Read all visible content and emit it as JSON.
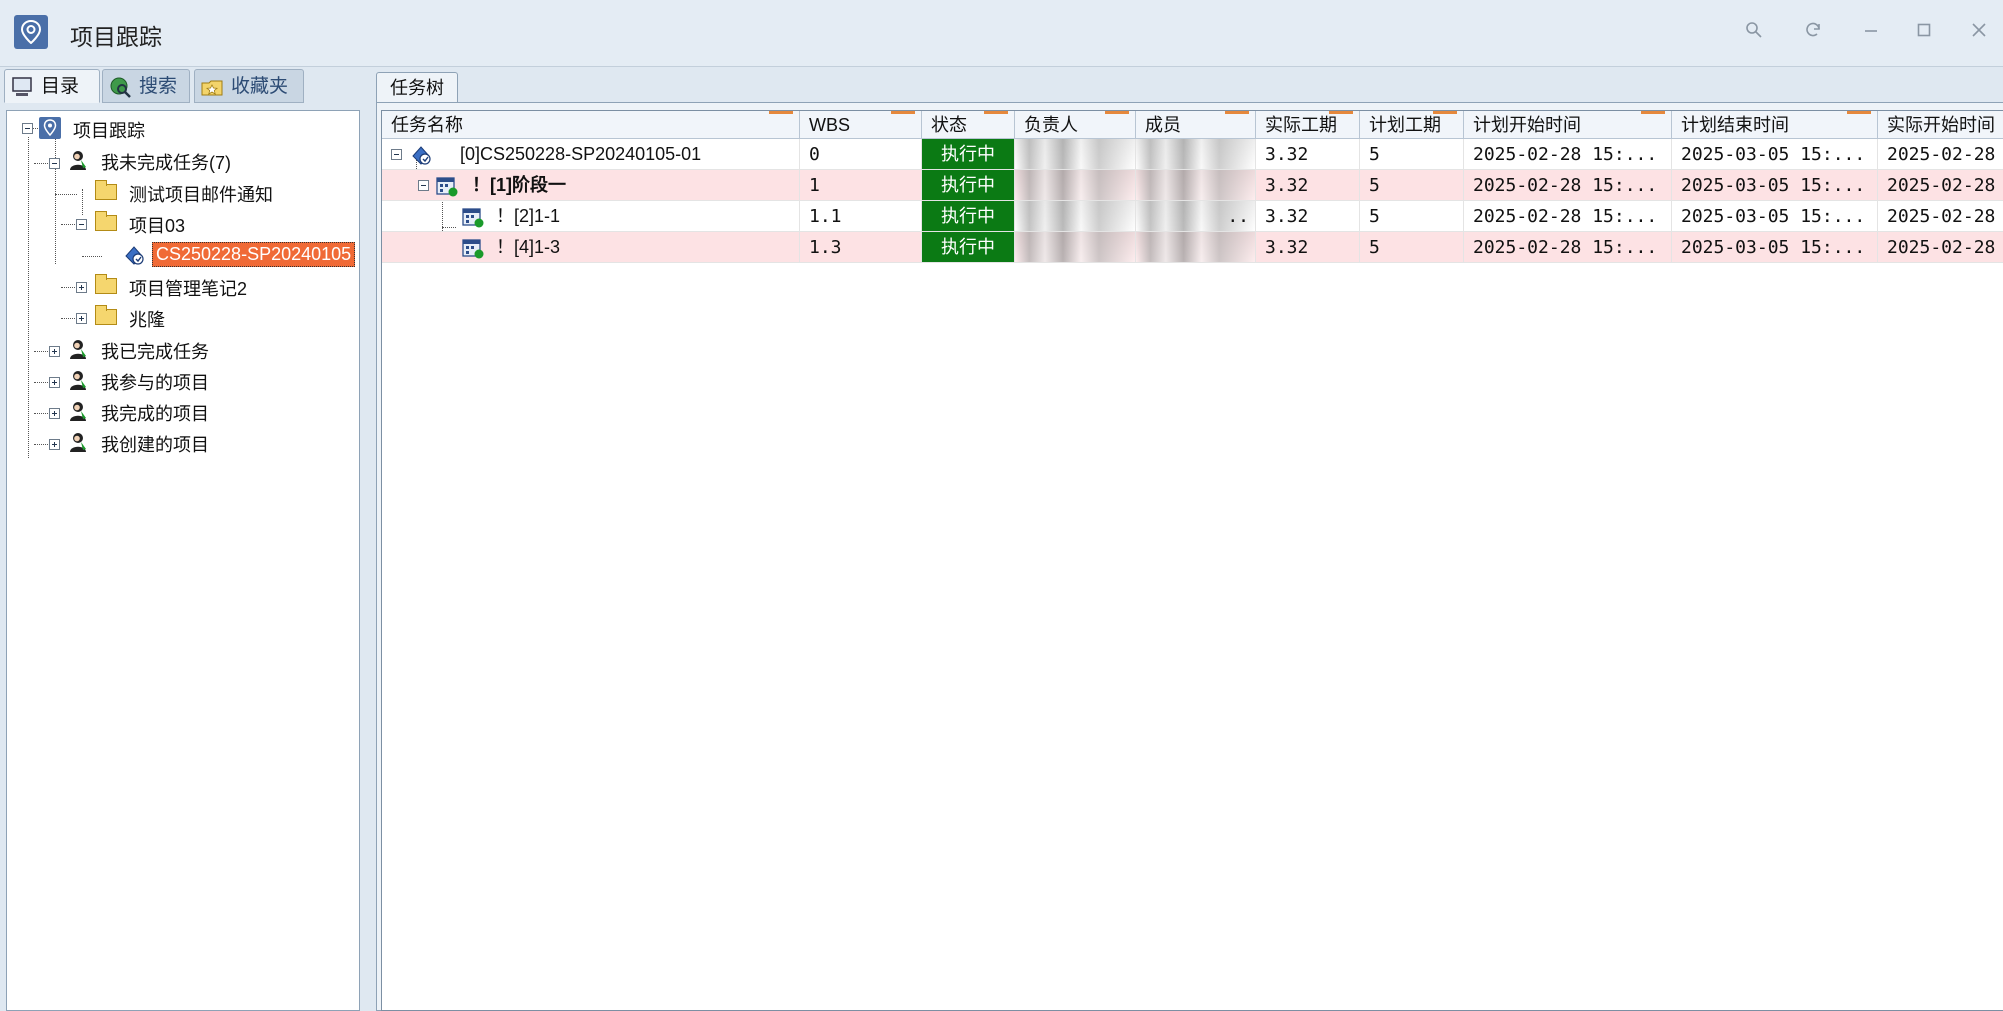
{
  "window": {
    "title": "项目跟踪",
    "controls": [
      "search-icon",
      "refresh-icon",
      "minimize-icon",
      "maximize-icon",
      "close-icon"
    ]
  },
  "left_tabs": [
    {
      "label": "目录",
      "icon": "computer-icon",
      "active": true
    },
    {
      "label": "搜索",
      "icon": "globe-search-icon",
      "active": false
    },
    {
      "label": "收藏夹",
      "icon": "favorites-folder-icon",
      "active": false
    }
  ],
  "tree": {
    "root": "项目跟踪",
    "nodes": [
      {
        "label": "我未完成任务(7)",
        "icon": "person-icon",
        "expanded": true
      },
      {
        "label": "测试项目邮件通知",
        "icon": "folder-icon"
      },
      {
        "label": "项目03",
        "icon": "folder-icon",
        "expanded": true
      },
      {
        "label": "CS250228-SP20240105",
        "icon": "project-icon",
        "selected": true
      },
      {
        "label": "项目管理笔记2",
        "icon": "folder-icon",
        "expanded": false
      },
      {
        "label": "兆隆",
        "icon": "folder-icon",
        "expanded": false
      },
      {
        "label": "我已完成任务",
        "icon": "person-icon",
        "expanded": false
      },
      {
        "label": "我参与的项目",
        "icon": "person-icon",
        "expanded": false
      },
      {
        "label": "我完成的项目",
        "icon": "person-icon",
        "expanded": false
      },
      {
        "label": "我创建的项目",
        "icon": "person-icon",
        "expanded": false
      }
    ]
  },
  "right_tabs": [
    {
      "label": "任务树",
      "active": true
    }
  ],
  "grid": {
    "columns": [
      "任务名称",
      "WBS",
      "状态",
      "负责人",
      "成员",
      "实际工期",
      "计划工期",
      "计划开始时间",
      "计划结束时间",
      "实际开始时间"
    ],
    "rows": [
      {
        "name": "[0]CS250228-SP20240105-01",
        "wbs": "0",
        "status": "执行中",
        "owner": "",
        "members": "",
        "actual_duration": "3.32",
        "planned_duration": "5",
        "plan_start": "2025-02-28 15:...",
        "plan_end": "2025-03-05 15:...",
        "actual_start": "2025-02-28"
      },
      {
        "name": "！[1]阶段一",
        "wbs": "1",
        "status": "执行中",
        "owner": "",
        "members": "",
        "actual_duration": "3.32",
        "planned_duration": "5",
        "plan_start": "2025-02-28 15:...",
        "plan_end": "2025-03-05 15:...",
        "actual_start": "2025-02-28"
      },
      {
        "name": "！[2]1-1",
        "wbs": "1.1",
        "status": "执行中",
        "owner": "",
        "members": "..",
        "actual_duration": "3.32",
        "planned_duration": "5",
        "plan_start": "2025-02-28 15:...",
        "plan_end": "2025-03-05 15:...",
        "actual_start": "2025-02-28"
      },
      {
        "name": "！[4]1-3",
        "wbs": "1.3",
        "status": "执行中",
        "owner": "",
        "members": "",
        "actual_duration": "3.32",
        "planned_duration": "5",
        "plan_start": "2025-02-28 15:...",
        "plan_end": "2025-03-05 15:...",
        "actual_start": "2025-02-28"
      }
    ]
  },
  "colors": {
    "status_running": "#0b7a14",
    "selected_node": "#f06a36",
    "row_highlight": "#fde2e4",
    "sort_marker": "#e5883c"
  }
}
